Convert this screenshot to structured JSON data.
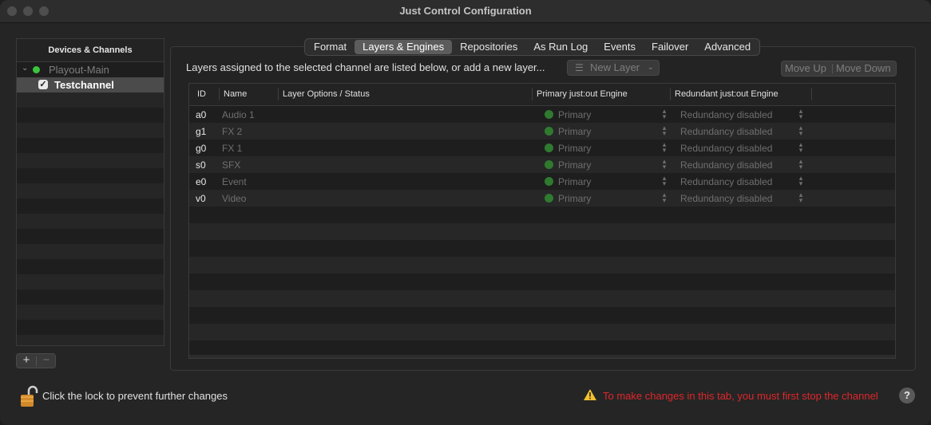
{
  "window": {
    "title": "Just Control Configuration"
  },
  "sidebar": {
    "header": "Devices & Channels",
    "device": {
      "name": "Playout-Main",
      "status_color": "#3cc43c"
    },
    "channel": {
      "name": "Testchannel",
      "checked": true
    },
    "add_label": "+",
    "remove_label": "−"
  },
  "tabs": [
    "Format",
    "Layers & Engines",
    "Repositories",
    "As Run Log",
    "Events",
    "Failover",
    "Advanced"
  ],
  "active_tab": "Layers & Engines",
  "hint": "Layers assigned to the selected channel are listed below, or add a new layer...",
  "toolbar": {
    "new_layer": "New Layer",
    "move_up": "Move Up",
    "move_down": "Move Down"
  },
  "table": {
    "headers": {
      "id": "ID",
      "name": "Name",
      "options": "Layer Options / Status",
      "primary": "Primary just:out Engine",
      "redundant": "Redundant just:out Engine"
    },
    "rows": [
      {
        "id": "a0",
        "name": "Audio 1",
        "primary": "Primary",
        "redundant": "Redundancy disabled"
      },
      {
        "id": "g1",
        "name": "FX 2",
        "primary": "Primary",
        "redundant": "Redundancy disabled"
      },
      {
        "id": "g0",
        "name": "FX 1",
        "primary": "Primary",
        "redundant": "Redundancy disabled"
      },
      {
        "id": "s0",
        "name": "SFX",
        "primary": "Primary",
        "redundant": "Redundancy disabled"
      },
      {
        "id": "e0",
        "name": "Event",
        "primary": "Primary",
        "redundant": "Redundancy disabled"
      },
      {
        "id": "v0",
        "name": "Video",
        "primary": "Primary",
        "redundant": "Redundancy disabled"
      }
    ]
  },
  "footer": {
    "lock_text": "Click the lock to prevent further changes",
    "warning": "To make changes in this tab, you must first stop the channel",
    "help": "?"
  },
  "colors": {
    "warning_text": "#e0262a",
    "status_green": "#3cc43c",
    "engine_dot": "#2f7a2f"
  }
}
